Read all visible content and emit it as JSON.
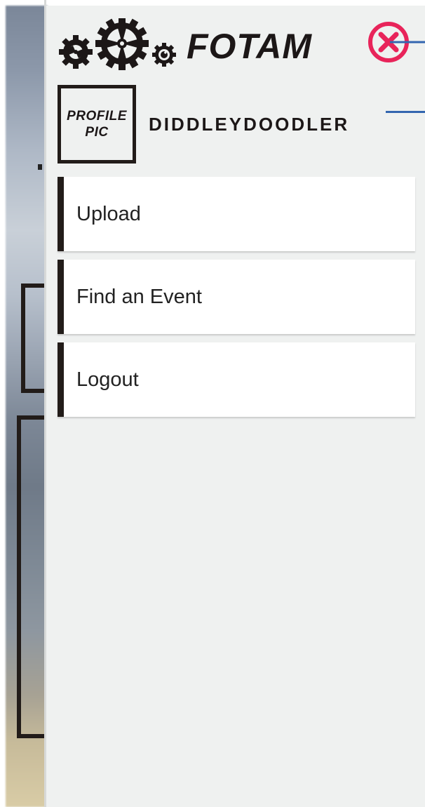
{
  "app": {
    "brand_name": "FOTAM",
    "logo_icon": "gears-logo-icon"
  },
  "header": {
    "close_icon": "close-circle-icon",
    "close_color": "#e8245a"
  },
  "profile": {
    "pic_label_line1": "PROFILE",
    "pic_label_line2": "PIC",
    "username": "DIDDLEYDOODLER"
  },
  "menu": {
    "items": [
      {
        "label": "Upload"
      },
      {
        "label": "Find an Event"
      },
      {
        "label": "Logout"
      }
    ]
  },
  "colors": {
    "drawer_bg": "#eff1f0",
    "text_dark": "#1c1717",
    "accent_blue": "#3366b0",
    "close_red": "#e8245a"
  }
}
